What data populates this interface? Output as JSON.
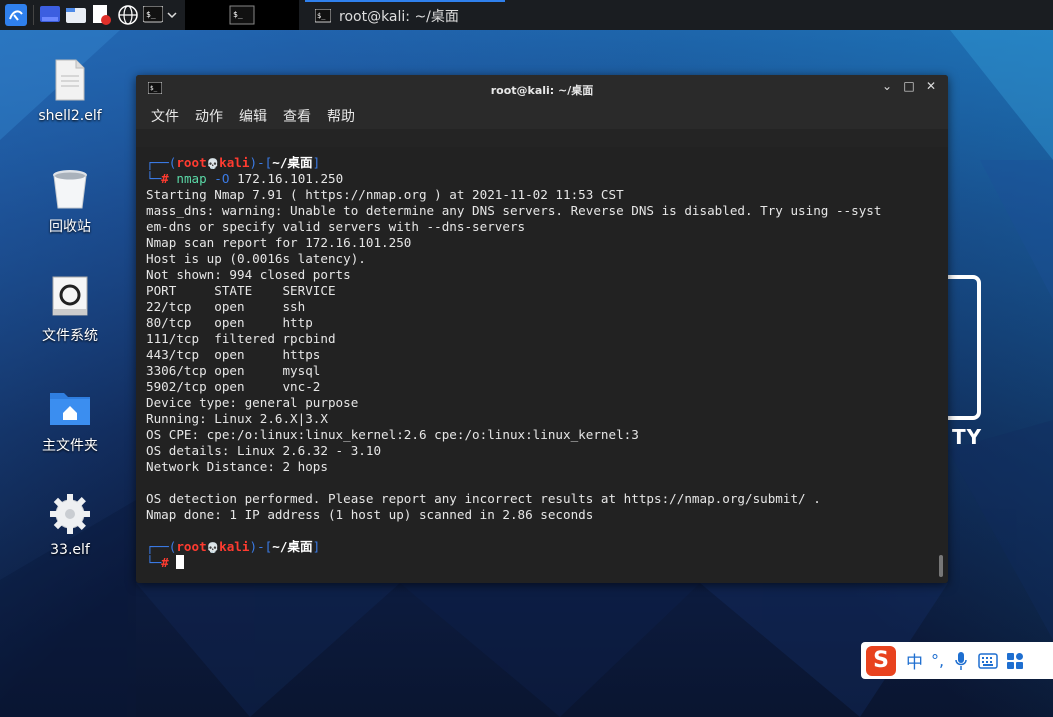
{
  "taskbar": {
    "task_title": "root@kali: ~/桌面"
  },
  "desktop_icons": [
    {
      "label": "shell2.elf",
      "icon": "file-icon"
    },
    {
      "label": "回收站",
      "icon": "trash-icon"
    },
    {
      "label": "文件系统",
      "icon": "drive-icon"
    },
    {
      "label": "主文件夹",
      "icon": "home-folder-icon"
    },
    {
      "label": "33.elf",
      "icon": "gear-file-icon"
    }
  ],
  "terminal": {
    "title": "root@kali: ~/桌面",
    "window_buttons": {
      "minimize": "⌄",
      "maximize": "□",
      "close": "✕"
    },
    "menu": [
      "文件",
      "动作",
      "编辑",
      "查看",
      "帮助"
    ],
    "prompt": {
      "user": "root",
      "skull": "💀",
      "host": "kali",
      "dir": "~/桌面",
      "hash": "#"
    },
    "command": {
      "name": "nmap",
      "flag": "-O",
      "arg": "172.16.101.250"
    },
    "output": [
      "Starting Nmap 7.91 ( https://nmap.org ) at 2021-11-02 11:53 CST",
      "mass_dns: warning: Unable to determine any DNS servers. Reverse DNS is disabled. Try using --syst",
      "em-dns or specify valid servers with --dns-servers",
      "Nmap scan report for 172.16.101.250",
      "Host is up (0.0016s latency).",
      "Not shown: 994 closed ports",
      "PORT     STATE    SERVICE",
      "22/tcp   open     ssh",
      "80/tcp   open     http",
      "111/tcp  filtered rpcbind",
      "443/tcp  open     https",
      "3306/tcp open     mysql",
      "5902/tcp open     vnc-2",
      "Device type: general purpose",
      "Running: Linux 2.6.X|3.X",
      "OS CPE: cpe:/o:linux:linux_kernel:2.6 cpe:/o:linux:linux_kernel:3",
      "OS details: Linux 2.6.32 - 3.10",
      "Network Distance: 2 hops",
      "",
      "OS detection performed. Please report any incorrect results at https://nmap.org/submit/ .",
      "Nmap done: 1 IP address (1 host up) scanned in 2.86 seconds"
    ]
  },
  "ime": {
    "logo": "S",
    "mode": "中",
    "punct": "°,"
  },
  "background_logo": {
    "text": "TY"
  },
  "colors": {
    "prompt_blue": "#3b7be6",
    "prompt_red": "#ff3b30",
    "command_green": "#5ad8a6",
    "taskbar_accent": "#2f80ed"
  }
}
